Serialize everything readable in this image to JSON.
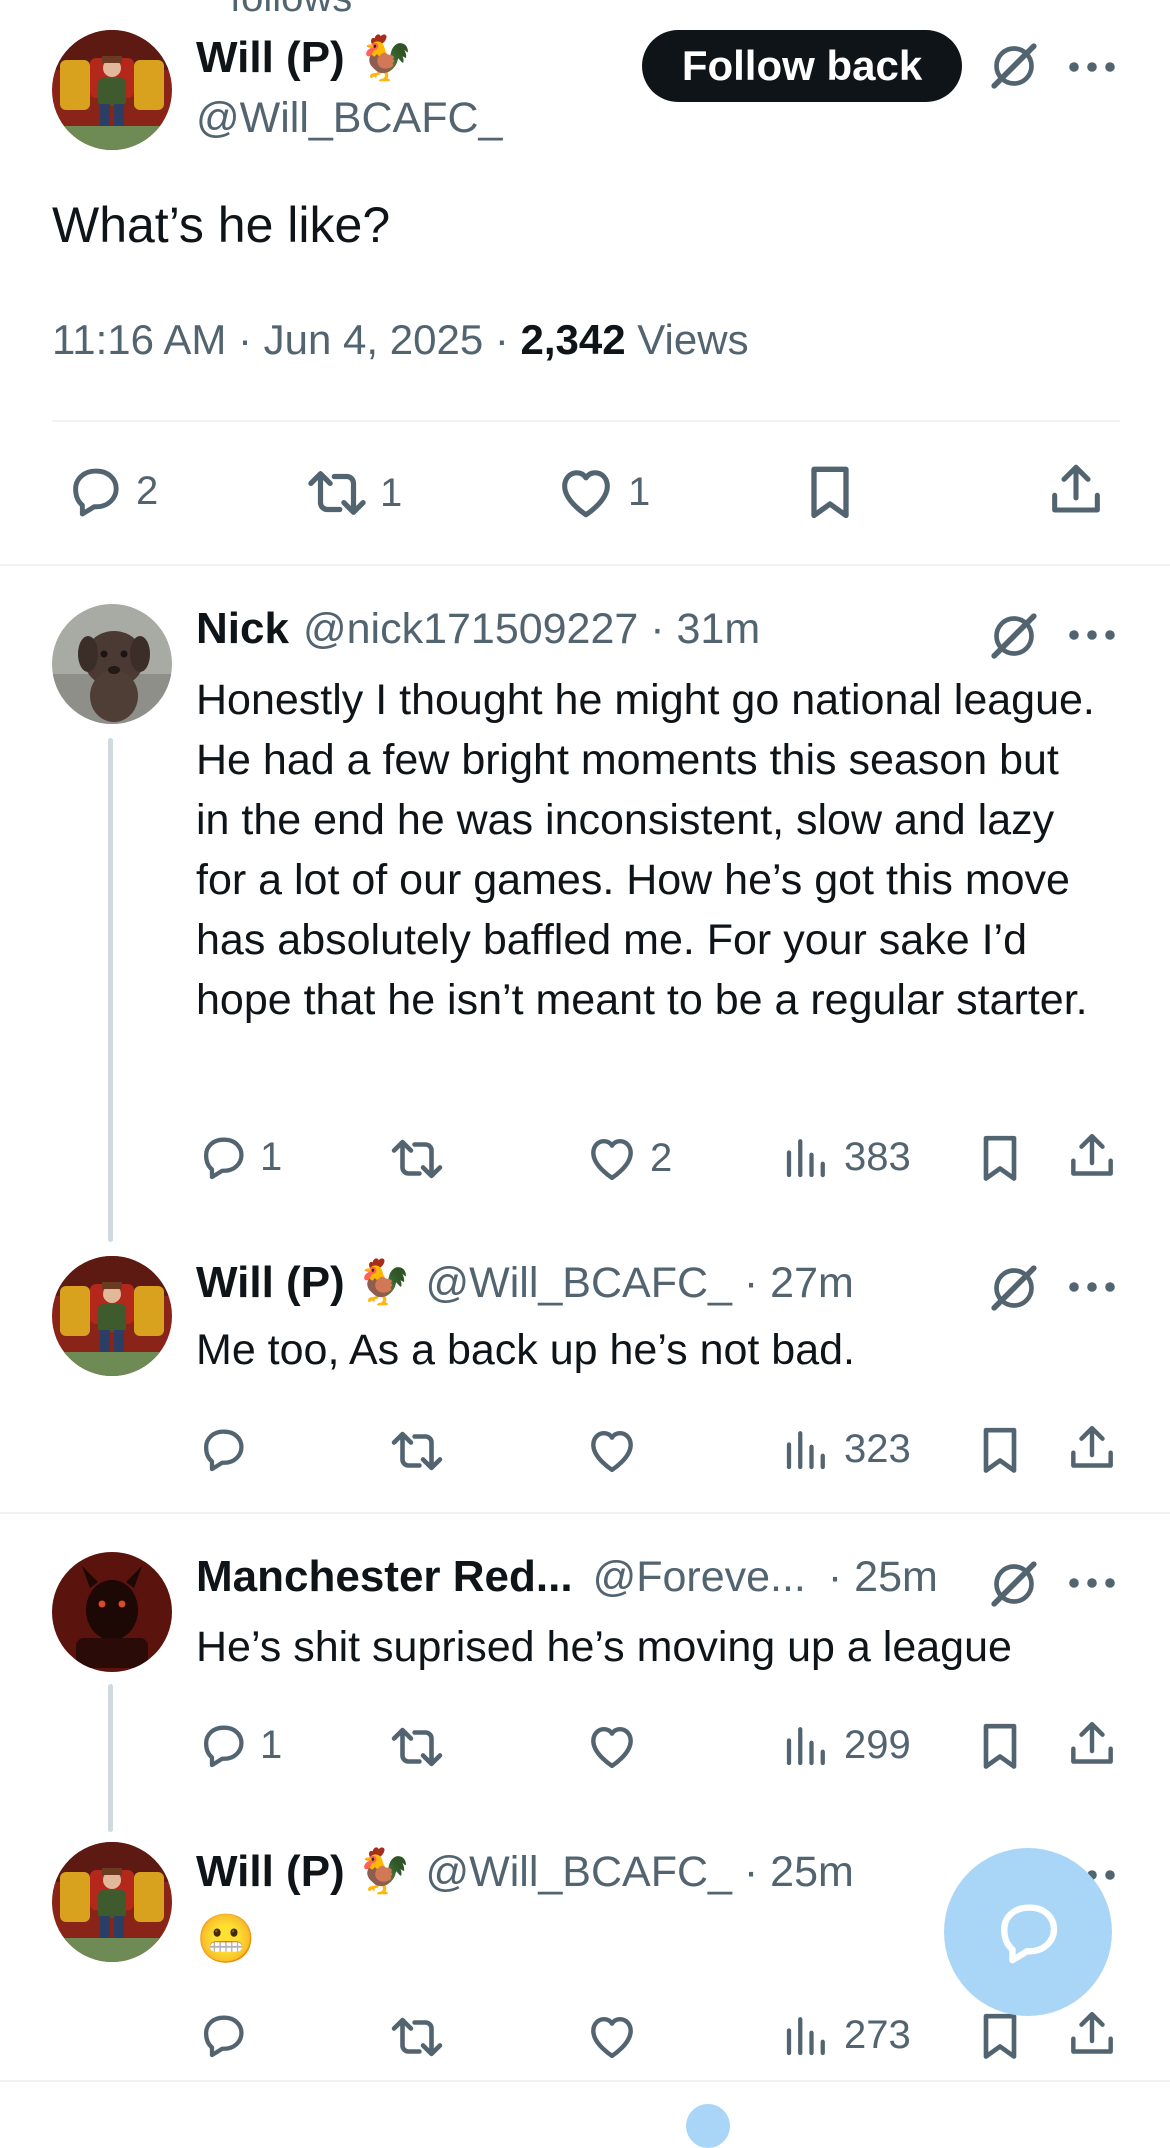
{
  "main_post": {
    "above_text": "follows",
    "author_name": "Will (P)",
    "emoji": "🐓",
    "handle": "@Will_BCAFC_",
    "follow_label": "Follow back",
    "text": "What’s he like?",
    "time": "11:16 AM · Jun 4, 2025 · ",
    "views_count": "2,342",
    "views_label": " Views",
    "actions": {
      "replies": "2",
      "reposts": "1",
      "likes": "1"
    }
  },
  "replies": [
    {
      "name": "Nick",
      "handle": "@nick171509227 · 31m",
      "text": "Honestly I thought he might go national league. He had a few bright moments this season but in the end he was inconsistent, slow and lazy for a lot of our games. How he’s got this move has absolutely baffled me. For your sake I’d hope that he isn’t meant to be a regular starter.",
      "replies": "1",
      "reposts": "",
      "likes": "2",
      "views": "383"
    },
    {
      "name": "Will (P)",
      "emoji": "🐓",
      "handle": "@Will_BCAFC_ · 27m",
      "text": "Me too, As a back up he’s not bad.",
      "replies": "",
      "reposts": "",
      "likes": "",
      "views": "323"
    },
    {
      "name": "Manchester Red...",
      "handle": "@Foreve...",
      "time": "· 25m",
      "text": "He’s shit suprised he’s moving up a league",
      "replies": "1",
      "reposts": "",
      "likes": "",
      "views": "299"
    },
    {
      "name": "Will (P)",
      "emoji": "🐓",
      "handle": "@Will_BCAFC_ · 25m",
      "text": "😬",
      "replies": "",
      "reposts": "",
      "likes": "",
      "views": "273"
    }
  ],
  "icons": {
    "reply": "speech-bubble-icon",
    "repost": "repost-arrows-icon",
    "like": "heart-icon",
    "views": "bar-chart-icon",
    "bookmark": "bookmark-icon",
    "share": "share-upload-icon",
    "grok": "grok-slash-icon",
    "more": "more-dots-icon",
    "compose": "compose-reply-icon"
  },
  "colors": {
    "text": "#0f1419",
    "secondary": "#536471",
    "fab": "#a9d6f7",
    "follow_button": "#0f1419"
  }
}
